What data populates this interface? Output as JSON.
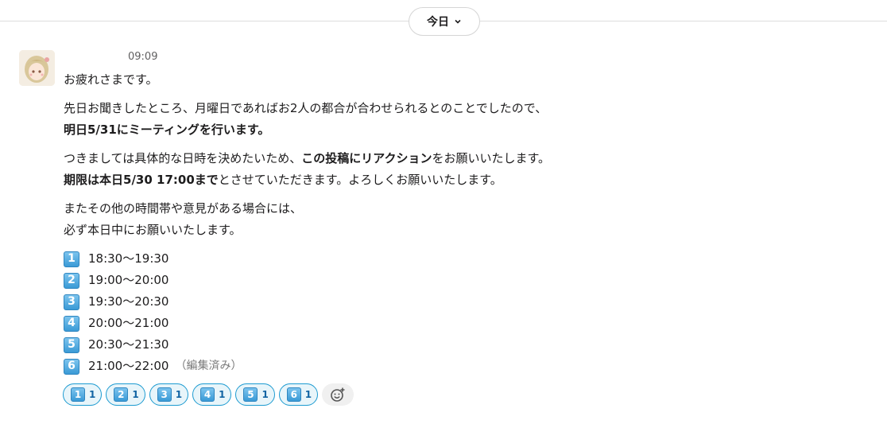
{
  "day_divider": {
    "label": "今日"
  },
  "message": {
    "time": "09:09",
    "paragraphs": [
      {
        "line1": "お疲れさまです。"
      },
      {
        "line1": "先日お聞きしたところ、月曜日であればお2人の都合が合わせられるとのことでしたので、",
        "line2_bold": "明日5/31にミーティングを行います。"
      },
      {
        "line1_pre": "つきましては具体的な日時を決めたいため、",
        "line1_bold": "この投稿にリアクション",
        "line1_post": "をお願いいたします。",
        "line2_bold": "期限は本日5/30 17:00まで",
        "line2_post": "とさせていただきます。よろしくお願いいたします。"
      },
      {
        "line1": "またその他の時間帯や意見がある場合には、",
        "line2": "必ず本日中にお願いいたします。"
      }
    ],
    "options": [
      {
        "key": "1",
        "time": "18:30〜19:30"
      },
      {
        "key": "2",
        "time": "19:00〜20:00"
      },
      {
        "key": "3",
        "time": "19:30〜20:30"
      },
      {
        "key": "4",
        "time": "20:00〜21:00"
      },
      {
        "key": "5",
        "time": "20:30〜21:30"
      },
      {
        "key": "6",
        "time": "21:00〜22:00"
      }
    ],
    "edited_label": "（編集済み）"
  },
  "reactions": [
    {
      "key": "1",
      "count": "1"
    },
    {
      "key": "2",
      "count": "1"
    },
    {
      "key": "3",
      "count": "1"
    },
    {
      "key": "4",
      "count": "1"
    },
    {
      "key": "5",
      "count": "1"
    },
    {
      "key": "6",
      "count": "1"
    }
  ],
  "colors": {
    "accent": "#1d9bd1",
    "keycap": "#3a9ad6",
    "text": "#1d1c1d"
  }
}
